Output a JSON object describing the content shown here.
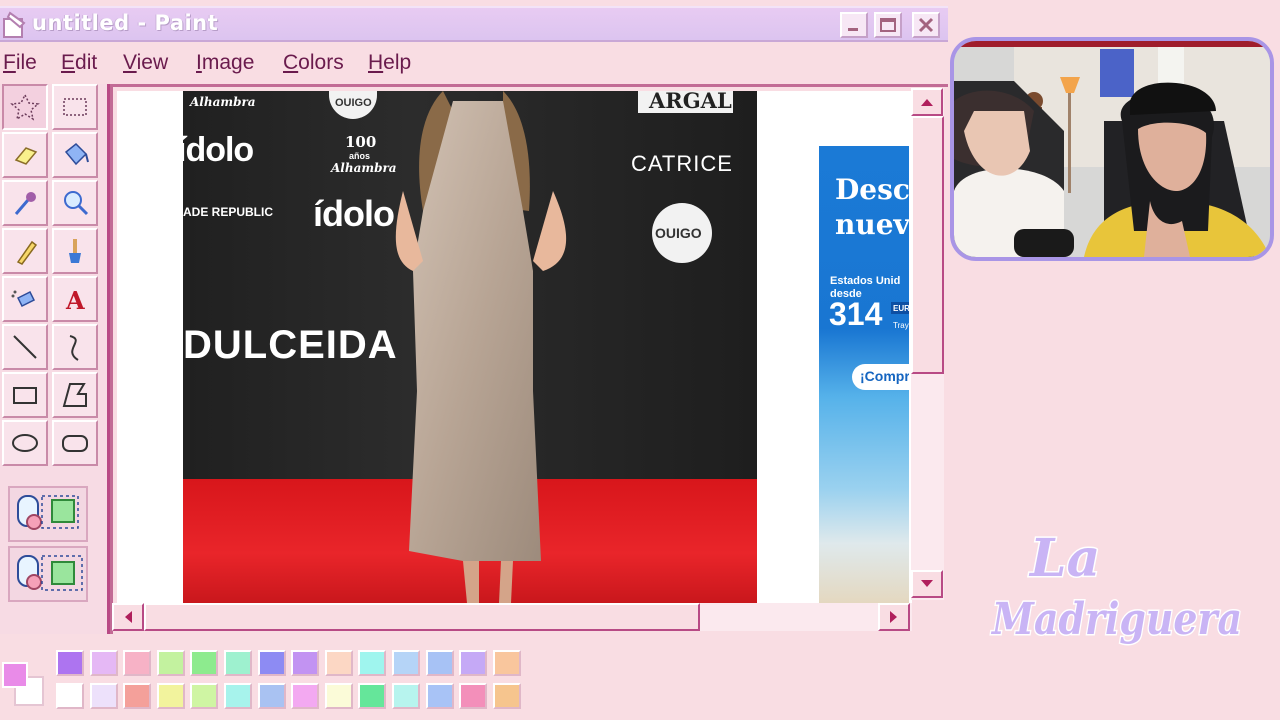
{
  "window": {
    "title": "untitled - Paint",
    "controls": {
      "minimize": "minimize",
      "maximize": "maximize",
      "close": "close"
    }
  },
  "menu": [
    {
      "key": "F",
      "rest": "ile"
    },
    {
      "key": "E",
      "rest": "dit"
    },
    {
      "key": "V",
      "rest": "iew"
    },
    {
      "key": "I",
      "rest": "mage"
    },
    {
      "key": "C",
      "rest": "olors"
    },
    {
      "key": "H",
      "rest": "elp"
    }
  ],
  "tools": [
    "free-form-select-icon",
    "rectangle-select-icon",
    "eraser-icon",
    "fill-bucket-icon",
    "color-picker-icon",
    "magnifier-icon",
    "pencil-icon",
    "brush-icon",
    "airbrush-icon",
    "text-icon",
    "line-icon",
    "curve-icon",
    "rectangle-icon",
    "polygon-icon",
    "ellipse-icon",
    "rounded-rectangle-icon"
  ],
  "photo": {
    "logos": {
      "alhambra_small": "Alhambra",
      "ouigo_top": "OUIGO",
      "argal": "ARGAL",
      "idolo_left": "ídolo",
      "alhambra_100_line1": "100",
      "alhambra_100_line2": "años",
      "alhambra_100_line3": "Alhambra",
      "catrice": "CATRICE",
      "trade_republic": "ADE REPUBLIC",
      "idolo_center": "ídolo",
      "ouigo_circle": "OUIGO",
      "dulceida": "DULCEIDA"
    }
  },
  "ad": {
    "headline": "Desc\nnuev",
    "small_text": "Estados Unid\ndesde",
    "price": "314",
    "currency": "EUR",
    "sub": "Tray",
    "cta": "¡Compr"
  },
  "palette": {
    "colors": [
      "#ad74f0",
      "#e5b8f5",
      "#f7b2c6",
      "#c3f29f",
      "#8deb8e",
      "#9ef1cf",
      "#8d8bf3",
      "#c293f2",
      "#fcd7c4",
      "#9ff5ee",
      "#b5d4f7",
      "#a7c2f5",
      "#c5a9f6",
      "#f9c69d",
      "#ffffff",
      "#ede1fb",
      "#f4a09a",
      "#f2f39d",
      "#cff5a3",
      "#a7f3ec",
      "#a9c2f2",
      "#f3a9f1",
      "#fbfbd8",
      "#65e69a",
      "#b7f4ee",
      "#a8c3f6",
      "#f38fba",
      "#f6c58e"
    ],
    "foreground": "#e98be8",
    "background": "#ffffff"
  },
  "brand": {
    "line1": "La",
    "line2": "Madriguera"
  },
  "colors": {
    "accent": "#b84a85",
    "menu_text": "#6a1b4d",
    "webcam_border": "#a995e6"
  }
}
